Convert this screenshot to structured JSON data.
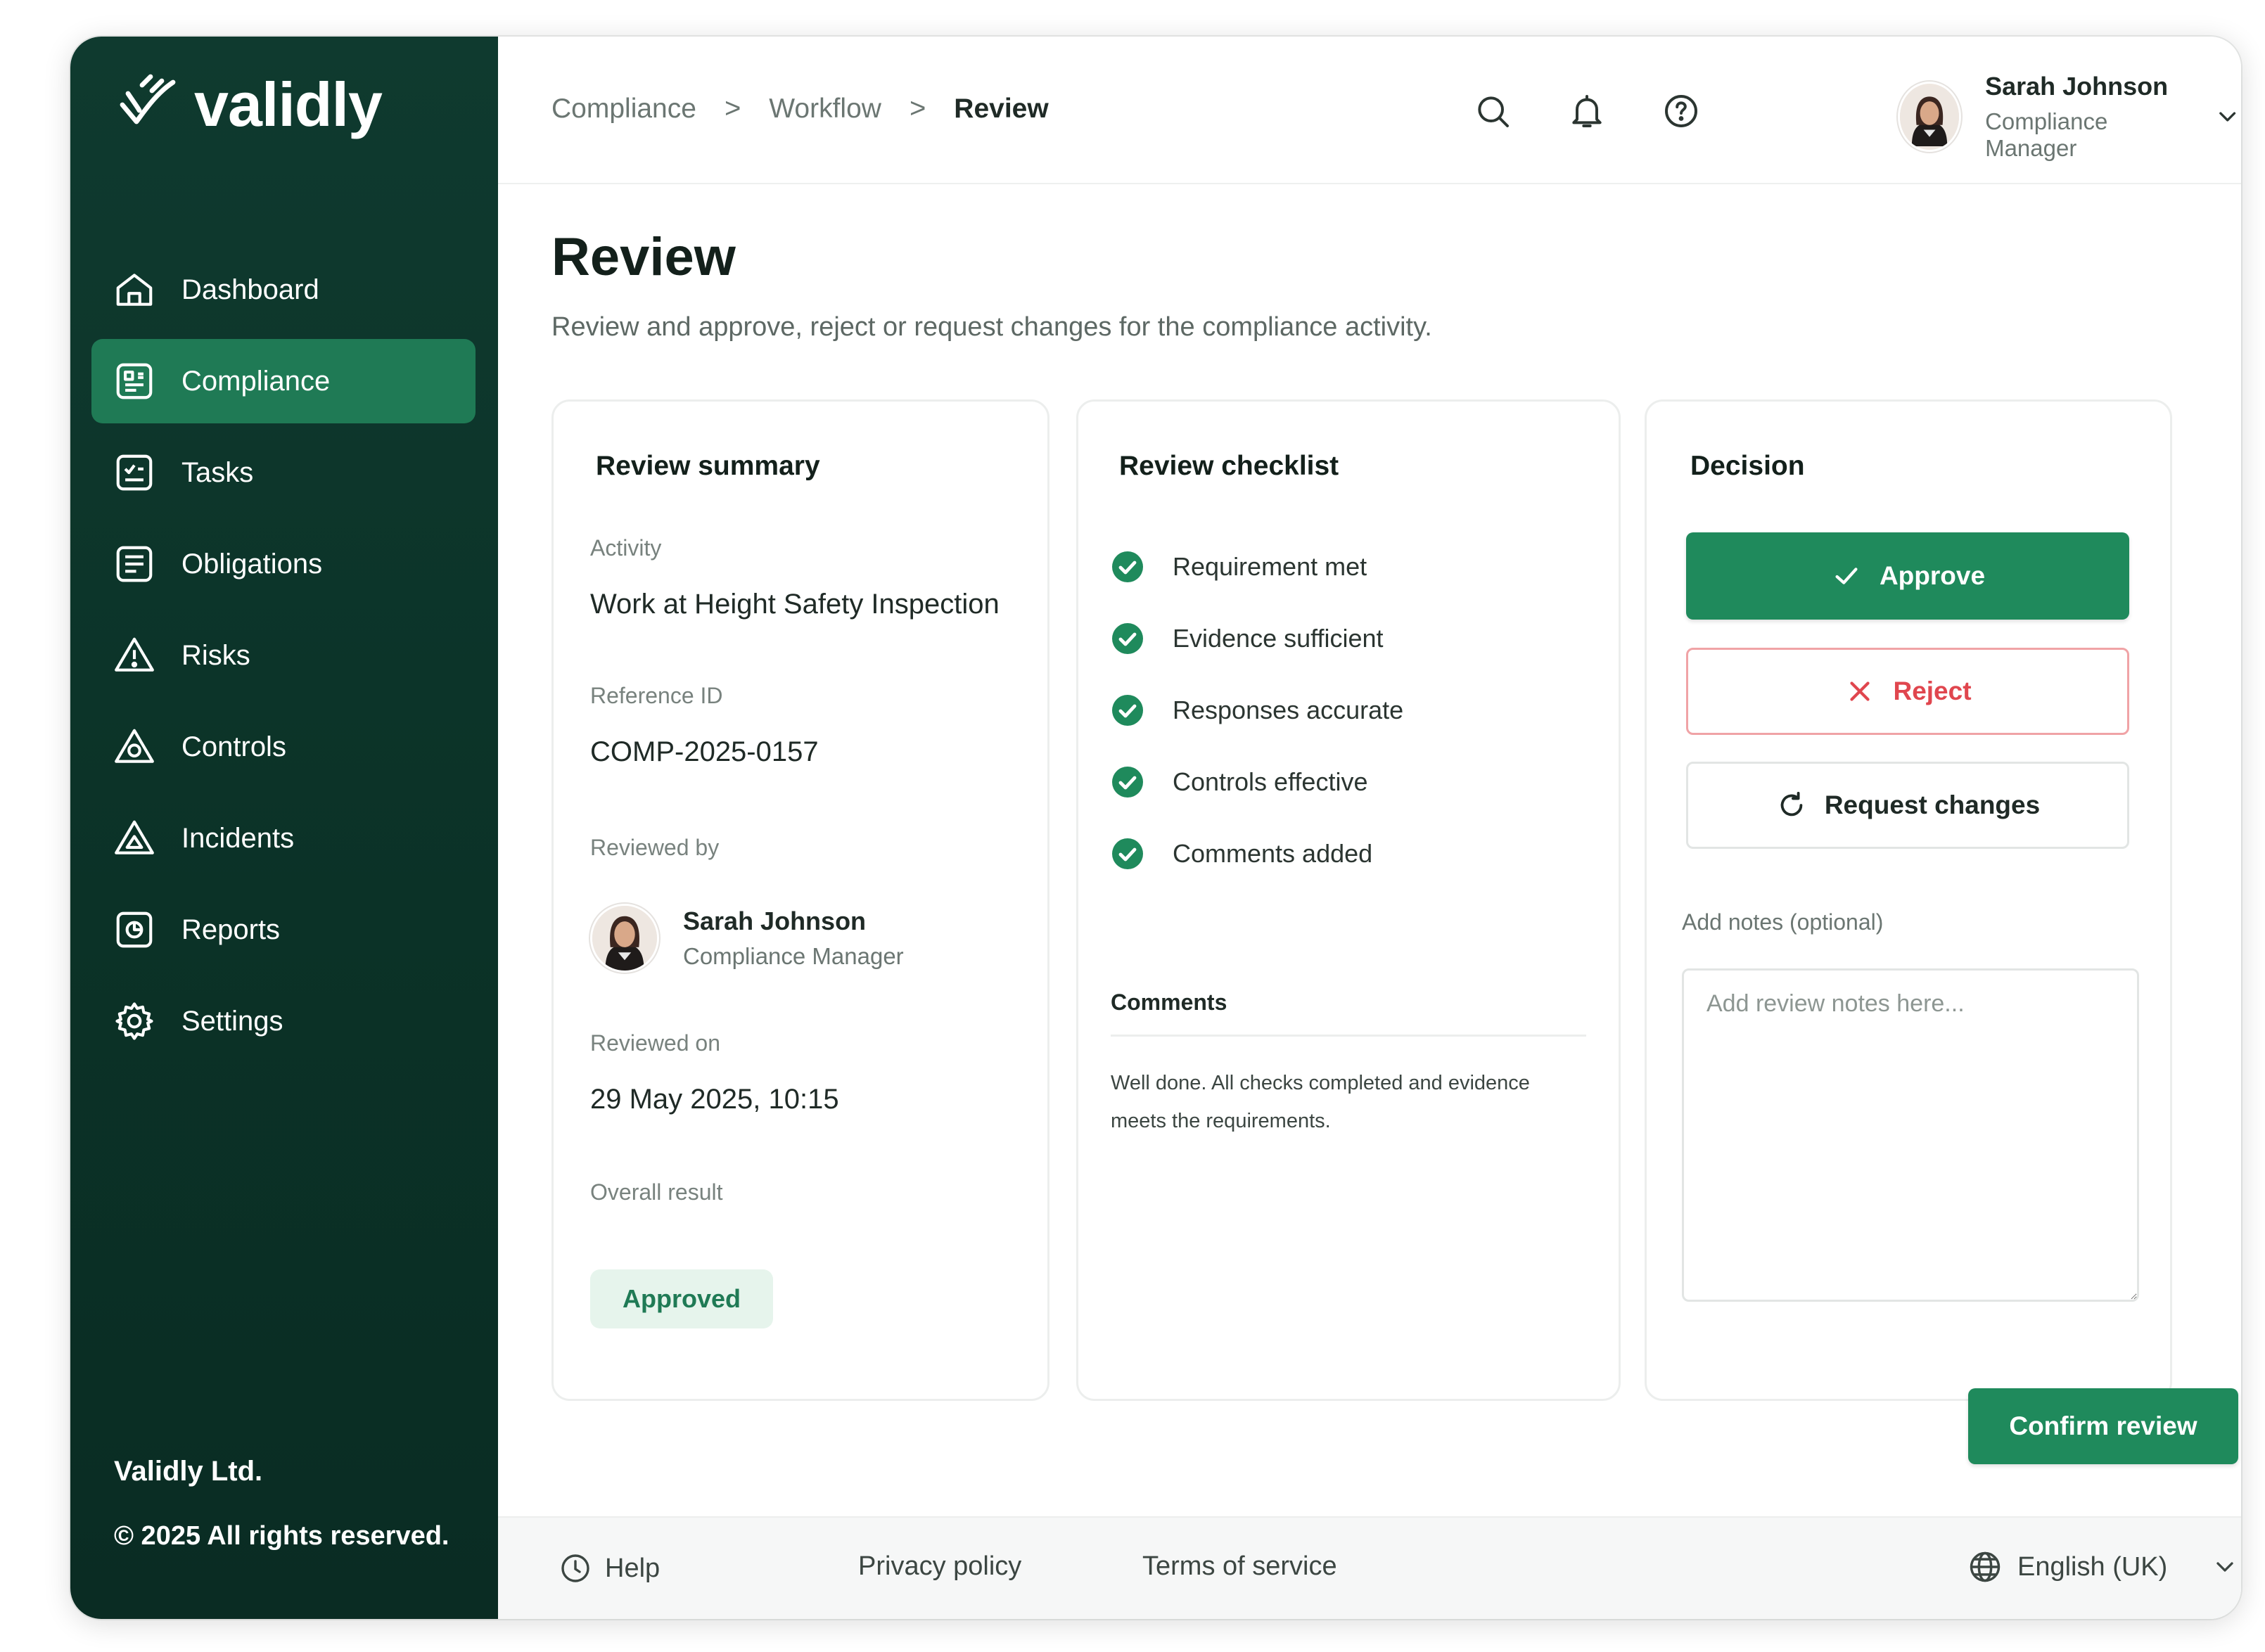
{
  "app": {
    "logo_text": "validly",
    "brand_color": "#1f7a55",
    "sidebar_color": "#0f3a2f"
  },
  "sidebar": {
    "items": [
      {
        "label": "Dashboard",
        "icon": "home-icon"
      },
      {
        "label": "Compliance",
        "icon": "compliance-icon",
        "active": true
      },
      {
        "label": "Tasks",
        "icon": "tasks-icon"
      },
      {
        "label": "Obligations",
        "icon": "obligations-icon"
      },
      {
        "label": "Risks",
        "icon": "warning-triangle-icon"
      },
      {
        "label": "Controls",
        "icon": "controls-triangle-icon"
      },
      {
        "label": "Incidents",
        "icon": "incidents-triangle-icon"
      },
      {
        "label": "Reports",
        "icon": "reports-icon"
      },
      {
        "label": "Settings",
        "icon": "gear-icon"
      }
    ],
    "company": "Validly Ltd.",
    "copyright": "© 2025 All rights reserved."
  },
  "header": {
    "breadcrumb": [
      "Compliance",
      "Workflow",
      "Review"
    ],
    "breadcrumb_separator": ">",
    "icons": [
      "search-icon",
      "bell-icon",
      "help-icon"
    ],
    "user": {
      "name": "Sarah Johnson",
      "role": "Compliance Manager"
    }
  },
  "page": {
    "title": "Review",
    "subtitle": "Review and approve, reject or request changes for the compliance activity."
  },
  "summary": {
    "title": "Review summary",
    "activity_label": "Activity",
    "activity_value": "Work at Height Safety Inspection",
    "reference_label": "Reference ID",
    "reference_value": "COMP-2025-0157",
    "reviewed_by_label": "Reviewed by",
    "reviewer_name": "Sarah Johnson",
    "reviewer_role": "Compliance Manager",
    "reviewed_on_label": "Reviewed on",
    "reviewed_on_value": "29 May 2025, 10:15",
    "result_label": "Overall result",
    "result_value": "Approved"
  },
  "checklist": {
    "title": "Review checklist",
    "items": [
      "Requirement met",
      "Evidence sufficient",
      "Responses accurate",
      "Controls effective",
      "Comments added"
    ],
    "comments_label": "Comments",
    "comments_text": "Well done. All checks completed and evidence meets the requirements."
  },
  "decision": {
    "title": "Decision",
    "approve_label": "Approve",
    "reject_label": "Reject",
    "request_label": "Request changes",
    "notes_label": "Add notes (optional)",
    "notes_placeholder": "Add review notes here...",
    "notes_value": ""
  },
  "actions": {
    "confirm_label": "Confirm review"
  },
  "footer": {
    "help": "Help",
    "privacy": "Privacy policy",
    "terms": "Terms of service",
    "language": "English (UK)"
  }
}
